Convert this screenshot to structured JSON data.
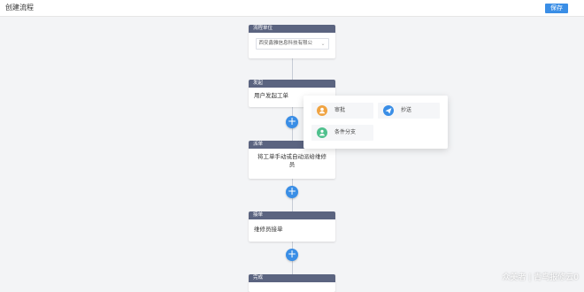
{
  "header": {
    "title": "创建流程",
    "save_label": "保存"
  },
  "nodes": {
    "start": {
      "head": "流程单位",
      "select_value": "西安鑫雅信息科技有限公"
    },
    "initiate": {
      "head": "发起",
      "body": "用户发起工单"
    },
    "dispatch": {
      "head": "派单",
      "body": "将工单手动或自动派给维修员"
    },
    "accept": {
      "head": "接单",
      "body": "维修员接单"
    },
    "finish": {
      "head": "完成"
    }
  },
  "popup": {
    "items": [
      {
        "label": "审批",
        "icon": "user-icon",
        "color": "#f0a341"
      },
      {
        "label": "抄送",
        "icon": "send-icon",
        "color": "#3a8ee6"
      },
      {
        "label": "条件分支",
        "icon": "branch-icon",
        "color": "#4fc08d"
      }
    ]
  },
  "watermark": "众美者 | 青鸟报修云0",
  "colors": {
    "accent": "#3a8ee6",
    "node_head": "#5b6480"
  }
}
